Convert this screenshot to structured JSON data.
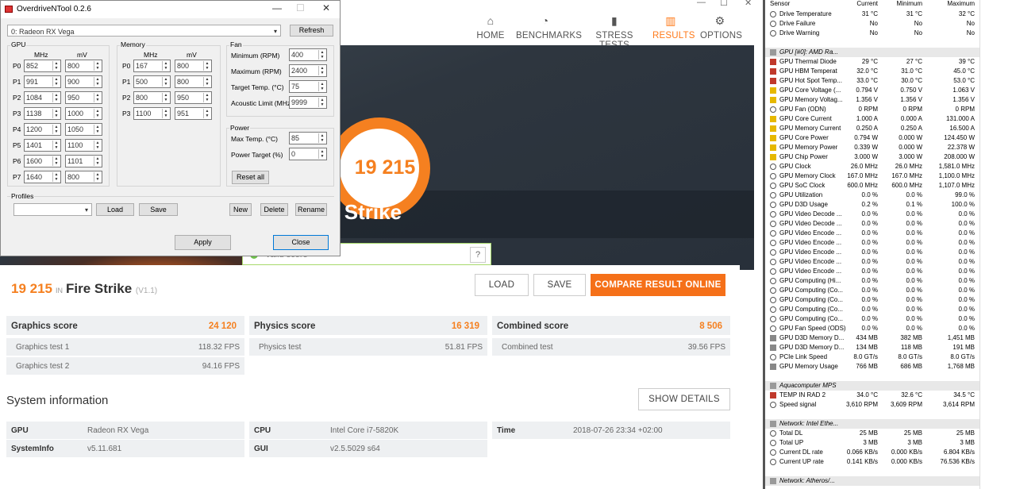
{
  "dm": {
    "nav": [
      {
        "label": "HOME",
        "icon": "⌂"
      },
      {
        "label": "BENCHMARKS",
        "icon": "◔"
      },
      {
        "label": "STRESS TESTS",
        "icon": "▮"
      },
      {
        "label": "RESULTS",
        "icon": "▥"
      },
      {
        "label": "OPTIONS",
        "icon": "⚙"
      }
    ],
    "ring_score": "19 215",
    "hero_title": "re Strike",
    "valid_text": "Valid score",
    "score_num": "19 215",
    "score_in": "IN",
    "score_name": "Fire Strike",
    "score_ver": "(V1.1)",
    "load": "LOAD",
    "save": "SAVE",
    "compare": "COMPARE RESULT ONLINE",
    "graphics": {
      "label": "Graphics score",
      "value": "24 120",
      "t1": "Graphics test 1",
      "t1v": "118.32 FPS",
      "t2": "Graphics test 2",
      "t2v": "94.16 FPS"
    },
    "physics": {
      "label": "Physics score",
      "value": "16 319",
      "t1": "Physics test",
      "t1v": "51.81 FPS"
    },
    "combined": {
      "label": "Combined score",
      "value": "8 506",
      "t1": "Combined test",
      "t1v": "39.56 FPS"
    },
    "sysinfo": "System information",
    "show_details": "SHOW DETAILS",
    "si": {
      "gpu_k": "GPU",
      "gpu_v": "Radeon RX Vega",
      "cpu_k": "CPU",
      "cpu_v": "Intel Core i7-5820K",
      "time_k": "Time",
      "time_v": "2018-07-26 23:34 +02:00",
      "sys_k": "SystemInfo",
      "sys_v": "v5.11.681",
      "gui_k": "GUI",
      "gui_v": "v2.5.5029 s64"
    }
  },
  "od": {
    "title": "OverdriveNTool 0.2.6",
    "device": "0: Radeon RX Vega",
    "refresh": "Refresh",
    "gpu_label": "GPU",
    "mem_label": "Memory",
    "fan_label": "Fan",
    "power_label": "Power",
    "profiles_label": "Profiles",
    "mhz": "MHz",
    "mv": "mV",
    "gpu_states": [
      [
        "P0",
        "852",
        "800"
      ],
      [
        "P1",
        "991",
        "900"
      ],
      [
        "P2",
        "1084",
        "950"
      ],
      [
        "P3",
        "1138",
        "1000"
      ],
      [
        "P4",
        "1200",
        "1050"
      ],
      [
        "P5",
        "1401",
        "1100"
      ],
      [
        "P6",
        "1600",
        "1101"
      ],
      [
        "P7",
        "1640",
        "800"
      ]
    ],
    "mem_states": [
      [
        "P0",
        "167",
        "800"
      ],
      [
        "P1",
        "500",
        "800"
      ],
      [
        "P2",
        "800",
        "950"
      ],
      [
        "P3",
        "1100",
        "951"
      ]
    ],
    "fan": [
      [
        "Minimum (RPM)",
        "400"
      ],
      [
        "Maximum (RPM)",
        "2400"
      ],
      [
        "Target Temp. (°C)",
        "75"
      ],
      [
        "Acoustic Limit (MHz)",
        "9999"
      ]
    ],
    "power": [
      [
        "Max Temp. (°C)",
        "85"
      ],
      [
        "Power Target (%)",
        "0"
      ]
    ],
    "reset": "Reset all",
    "load": "Load",
    "save": "Save",
    "new": "New",
    "delete": "Delete",
    "rename": "Rename",
    "apply": "Apply",
    "close": "Close"
  },
  "hw": {
    "headers": [
      "Sensor",
      "Current",
      "Minimum",
      "Maximum"
    ],
    "rows": [
      [
        "d",
        "Drive Temperature",
        "31 °C",
        "31 °C",
        "32 °C"
      ],
      [
        "d",
        "Drive Failure",
        "No",
        "No",
        "No"
      ],
      [
        "d",
        "Drive Warning",
        "No",
        "No",
        "No"
      ],
      [
        "s",
        "",
        null,
        null,
        null
      ],
      [
        "h",
        "GPU [#0]: AMD Ra...",
        "",
        "",
        ""
      ],
      [
        "t",
        "GPU Thermal Diode",
        "29 °C",
        "27 °C",
        "39 °C"
      ],
      [
        "t",
        "GPU HBM Temperat",
        "32.0 °C",
        "31.0 °C",
        "45.0 °C"
      ],
      [
        "t",
        "GPU Hot Spot Temp...",
        "33.0 °C",
        "30.0 °C",
        "53.0 °C"
      ],
      [
        "v",
        "GPU Core Voltage (...",
        "0.794 V",
        "0.750 V",
        "1.063 V"
      ],
      [
        "v",
        "GPU Memory Voltag...",
        "1.356 V",
        "1.356 V",
        "1.356 V"
      ],
      [
        "f",
        "GPU Fan (ODN)",
        "0 RPM",
        "0 RPM",
        "0 RPM"
      ],
      [
        "v",
        "GPU Core Current",
        "1.000 A",
        "0.000 A",
        "131.000 A"
      ],
      [
        "v",
        "GPU Memory Current",
        "0.250 A",
        "0.250 A",
        "16.500 A"
      ],
      [
        "v",
        "GPU Core Power",
        "0.794 W",
        "0.000 W",
        "124.450 W"
      ],
      [
        "v",
        "GPU Memory Power",
        "0.339 W",
        "0.000 W",
        "22.378 W"
      ],
      [
        "v",
        "GPU Chip Power",
        "3.000 W",
        "3.000 W",
        "208.000 W"
      ],
      [
        "c",
        "GPU Clock",
        "26.0 MHz",
        "26.0 MHz",
        "1,581.0 MHz"
      ],
      [
        "c",
        "GPU Memory Clock",
        "167.0 MHz",
        "167.0 MHz",
        "1,100.0 MHz"
      ],
      [
        "c",
        "GPU SoC Clock",
        "600.0 MHz",
        "600.0 MHz",
        "1,107.0 MHz"
      ],
      [
        "c",
        "GPU Utilization",
        "0.0 %",
        "0.0 %",
        "99.0 %"
      ],
      [
        "c",
        "GPU D3D Usage",
        "0.2 %",
        "0.1 %",
        "100.0 %"
      ],
      [
        "c",
        "GPU Video Decode ...",
        "0.0 %",
        "0.0 %",
        "0.0 %"
      ],
      [
        "c",
        "GPU Video Decode ...",
        "0.0 %",
        "0.0 %",
        "0.0 %"
      ],
      [
        "c",
        "GPU Video Encode ...",
        "0.0 %",
        "0.0 %",
        "0.0 %"
      ],
      [
        "c",
        "GPU Video Encode ...",
        "0.0 %",
        "0.0 %",
        "0.0 %"
      ],
      [
        "c",
        "GPU Video Encode ...",
        "0.0 %",
        "0.0 %",
        "0.0 %"
      ],
      [
        "c",
        "GPU Video Encode ...",
        "0.0 %",
        "0.0 %",
        "0.0 %"
      ],
      [
        "c",
        "GPU Video Encode ...",
        "0.0 %",
        "0.0 %",
        "0.0 %"
      ],
      [
        "c",
        "GPU Computing (Hi...",
        "0.0 %",
        "0.0 %",
        "0.0 %"
      ],
      [
        "c",
        "GPU Computing (Co...",
        "0.0 %",
        "0.0 %",
        "0.0 %"
      ],
      [
        "c",
        "GPU Computing (Co...",
        "0.0 %",
        "0.0 %",
        "0.0 %"
      ],
      [
        "c",
        "GPU Computing (Co...",
        "0.0 %",
        "0.0 %",
        "0.0 %"
      ],
      [
        "c",
        "GPU Computing (Co...",
        "0.0 %",
        "0.0 %",
        "0.0 %"
      ],
      [
        "c",
        "GPU Fan Speed (ODS)",
        "0.0 %",
        "0.0 %",
        "0.0 %"
      ],
      [
        "m",
        "GPU D3D Memory D...",
        "434 MB",
        "382 MB",
        "1,451 MB"
      ],
      [
        "m",
        "GPU D3D Memory D...",
        "134 MB",
        "118 MB",
        "191 MB"
      ],
      [
        "c",
        "PCIe Link Speed",
        "8.0 GT/s",
        "8.0 GT/s",
        "8.0 GT/s"
      ],
      [
        "m",
        "GPU Memory Usage",
        "766 MB",
        "686 MB",
        "1,768 MB"
      ],
      [
        "s",
        "",
        null,
        null,
        null
      ],
      [
        "h",
        "Aquacomputer MPS",
        "",
        "",
        ""
      ],
      [
        "t",
        "TEMP IN RAD 2",
        "34.0 °C",
        "32.6 °C",
        "34.5 °C"
      ],
      [
        "c",
        "Speed signal",
        "3,610 RPM",
        "3,609 RPM",
        "3,614 RPM"
      ],
      [
        "s",
        "",
        null,
        null,
        null
      ],
      [
        "h",
        "Network: Intel Ethe...",
        "",
        "",
        ""
      ],
      [
        "c",
        "Total DL",
        "25 MB",
        "25 MB",
        "25 MB"
      ],
      [
        "c",
        "Total UP",
        "3 MB",
        "3 MB",
        "3 MB"
      ],
      [
        "c",
        "Current DL rate",
        "0.066 KB/s",
        "0.000 KB/s",
        "6.804 KB/s"
      ],
      [
        "c",
        "Current UP rate",
        "0.141 KB/s",
        "0.000 KB/s",
        "76.536 KB/s"
      ],
      [
        "s",
        "",
        null,
        null,
        null
      ],
      [
        "h",
        "Network: Atheros/...",
        "",
        "",
        ""
      ]
    ]
  }
}
